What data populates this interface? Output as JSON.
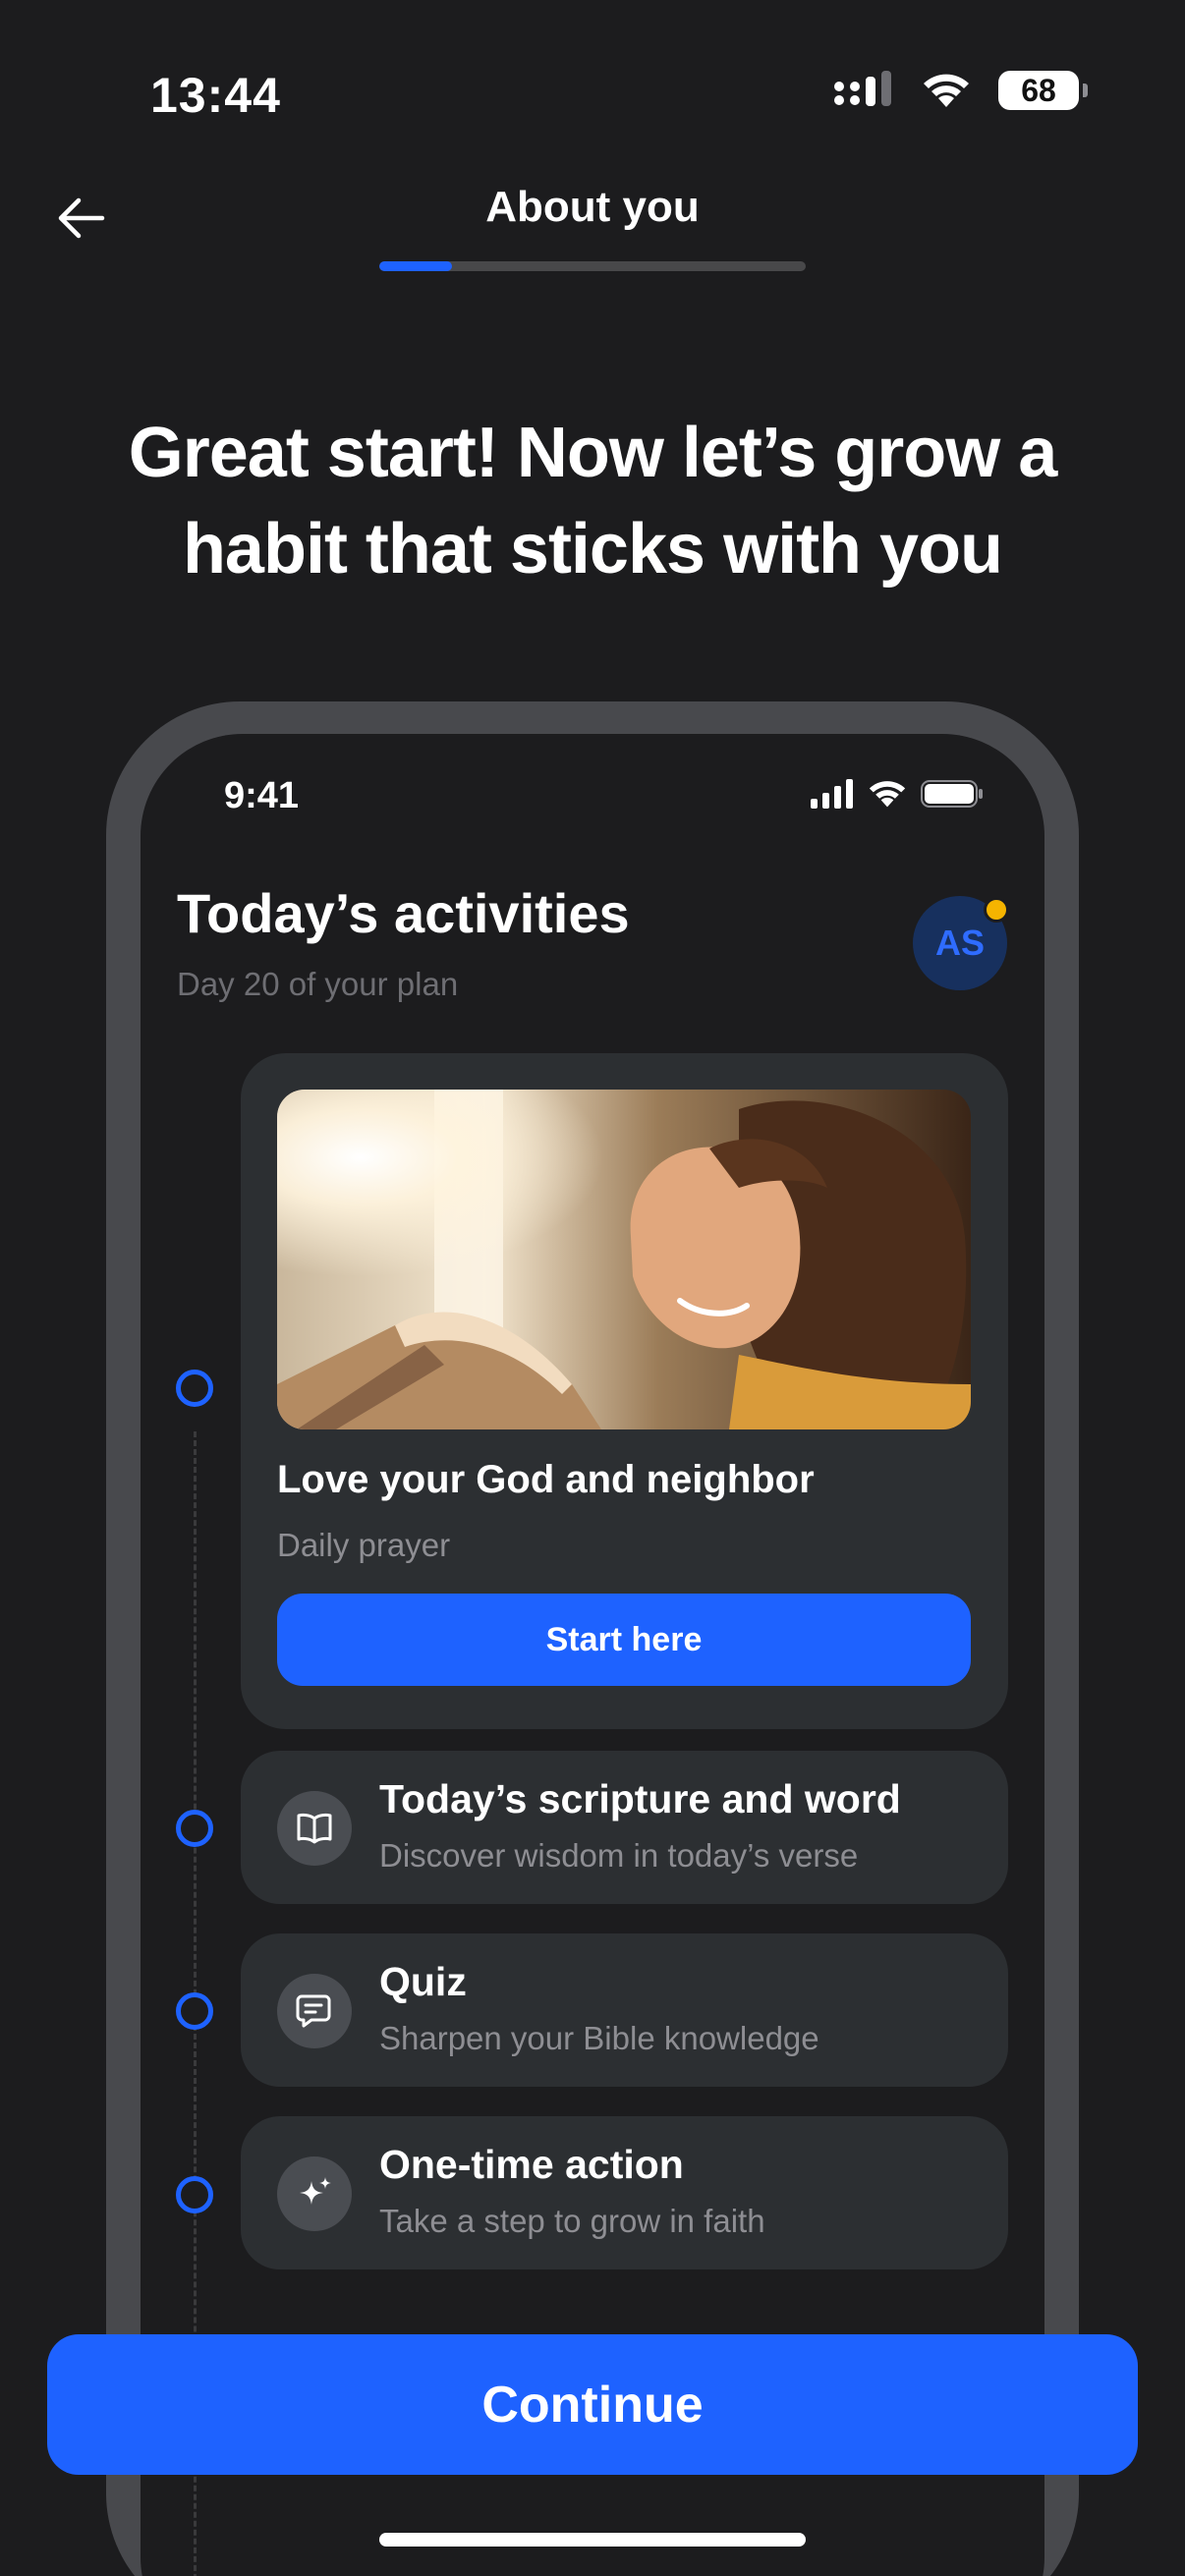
{
  "status_bar": {
    "time": "13:44",
    "battery": "68"
  },
  "header": {
    "title": "About you",
    "progress_fraction": 0.17
  },
  "headline": "Great start! Now let’s grow a habit that sticks with you",
  "preview": {
    "status_time": "9:41",
    "title": "Today’s activities",
    "subtitle": "Day 20 of your plan",
    "avatar_initials": "AS",
    "featured": {
      "title": "Love your God and neighbor",
      "subtitle": "Daily prayer",
      "button": "Start here"
    },
    "activities": [
      {
        "title": "Today’s scripture and word",
        "subtitle": "Discover wisdom in today’s verse",
        "icon": "book-icon"
      },
      {
        "title": "Quiz",
        "subtitle": "Sharpen your Bible knowledge",
        "icon": "quiz-icon"
      },
      {
        "title": "One-time action",
        "subtitle": "Take a step to grow in faith",
        "icon": "sparkle-icon"
      }
    ]
  },
  "continue_button": "Continue",
  "colors": {
    "background": "#1c1c1e",
    "accent": "#1e62ff",
    "card": "#2c2f32",
    "badge": "#f5b400"
  }
}
